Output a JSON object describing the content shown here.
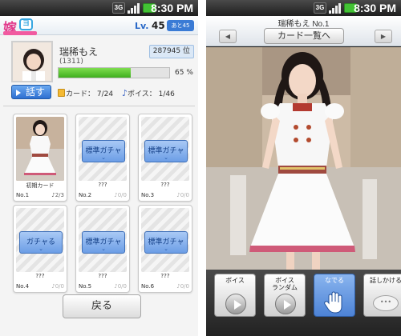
{
  "status_bar": {
    "network": "3G",
    "time": "8:30 PM"
  },
  "left_screen": {
    "header": {
      "level_prefix": "Lv.",
      "level": "45",
      "next_badge": "あと45"
    },
    "profile": {
      "name": "瑞稀もえ",
      "id": "(1311)",
      "rank": "287945 位",
      "progress_percent": 65,
      "progress_text": "65 %",
      "talk_button": "話す",
      "cards_stat": "カード： 7/24",
      "voice_stat": "ボイス： 1/46"
    },
    "cards": [
      {
        "title": "初期カード",
        "number": "No.1",
        "voice": "♪2/3",
        "gacha": "",
        "state": "photo"
      },
      {
        "title": "???",
        "number": "No.2",
        "voice": "♪0/0",
        "gacha": "標準ガチャ",
        "state": "locked"
      },
      {
        "title": "???",
        "number": "No.3",
        "voice": "♪0/0",
        "gacha": "標準ガチャ",
        "state": "locked"
      },
      {
        "title": "???",
        "number": "No.4",
        "voice": "♪0/0",
        "gacha": "ガチャる",
        "state": "locked"
      },
      {
        "title": "???",
        "number": "No.5",
        "voice": "♪0/0",
        "gacha": "標準ガチャ",
        "state": "locked"
      },
      {
        "title": "???",
        "number": "No.6",
        "voice": "♪0/0",
        "gacha": "標準ガチャ",
        "state": "locked"
      }
    ],
    "back_button": "戻る"
  },
  "right_screen": {
    "title": "瑞稀もえ No.1",
    "prev_button": "◀",
    "next_button": "▶",
    "card_list_button": "カード一覧へ",
    "actions": [
      {
        "label": "ボイス",
        "icon": "play-icon"
      },
      {
        "label": "ボイス\nランダム",
        "icon": "play-icon"
      },
      {
        "label": "なでる",
        "icon": "hand-icon"
      },
      {
        "label": "話しかける",
        "icon": "speech-bubble-icon"
      }
    ]
  },
  "colors": {
    "accent_blue": "#3a7bd5",
    "progress_green": "#4cc020",
    "brand_pink": "#e23b8c"
  }
}
